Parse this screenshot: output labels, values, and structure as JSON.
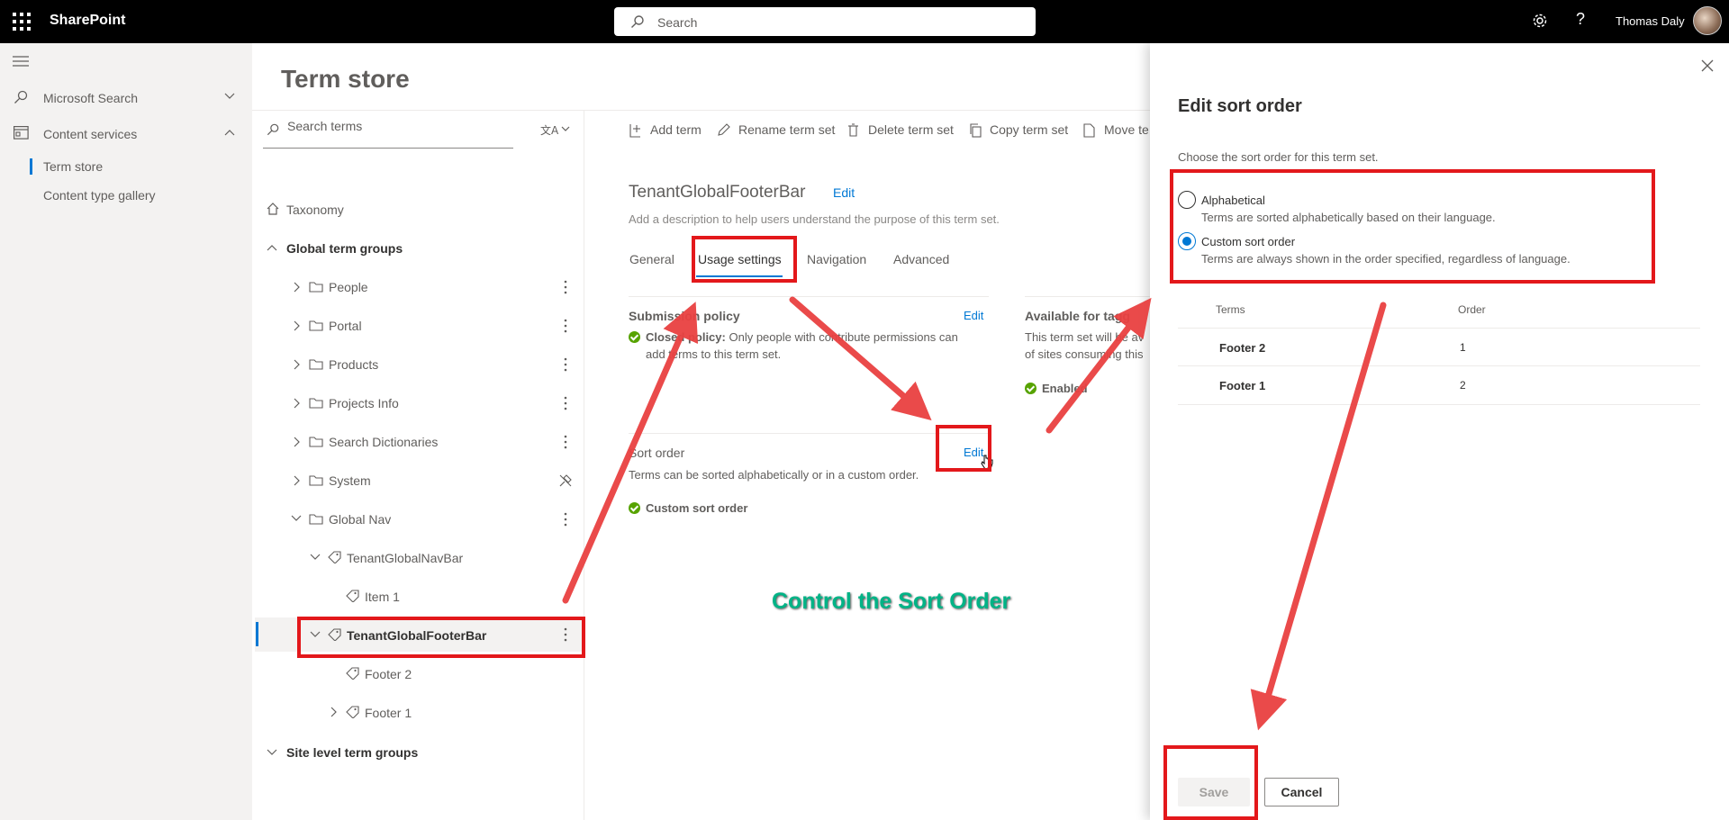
{
  "topbar": {
    "brand": "SharePoint",
    "search_placeholder": "Search",
    "user_name": "Thomas Daly",
    "help_label": "?"
  },
  "leftnav": {
    "items": [
      {
        "label": "Microsoft Search",
        "icon": "search-icon",
        "expanded": false
      },
      {
        "label": "Content services",
        "icon": "content-services-icon",
        "expanded": true
      }
    ],
    "sub_items": [
      "Term store",
      "Content type gallery"
    ],
    "selected": "Term store"
  },
  "page_title": "Term store",
  "tree": {
    "search_placeholder": "Search terms",
    "root": "Taxonomy",
    "global_group": "Global term groups",
    "groups": [
      "People",
      "Portal",
      "Products",
      "Projects Info",
      "Search Dictionaries",
      "System",
      "Global Nav"
    ],
    "term_sets": [
      "TenantGlobalNavBar",
      "TenantGlobalFooterBar"
    ],
    "nav_terms": [
      "Item 1"
    ],
    "footer_terms": [
      "Footer 2",
      "Footer 1"
    ],
    "site_group": "Site level term groups"
  },
  "commands": [
    "Add term",
    "Rename term set",
    "Delete term set",
    "Copy term set",
    "Move te"
  ],
  "termset": {
    "name": "TenantGlobalFooterBar",
    "edit_label": "Edit",
    "description": "Add a description to help users understand the purpose of this term set.",
    "tabs": [
      "General",
      "Usage settings",
      "Navigation",
      "Advanced"
    ],
    "active_tab": "Usage settings"
  },
  "cards": {
    "submission": {
      "title": "Submission policy",
      "edit": "Edit",
      "status_bold": "Closed policy:",
      "status_text": "Only people with contribute permissions can add terms to this term set."
    },
    "tagging": {
      "title": "Available for tagg",
      "text_line1": "This term set will be av",
      "text_line2": "of sites consuming this",
      "status": "Enabled"
    },
    "sort": {
      "title": "Sort order",
      "edit": "Edit",
      "text": "Terms can be sorted alphabetically or in a custom order.",
      "status": "Custom sort order"
    }
  },
  "caption": "Control the Sort Order",
  "panel": {
    "title": "Edit sort order",
    "description": "Choose the sort order for this term set.",
    "options": [
      {
        "label": "Alphabetical",
        "sub": "Terms are sorted alphabetically based on their language.",
        "selected": false
      },
      {
        "label": "Custom sort order",
        "sub": "Terms are always shown in the order specified, regardless of language.",
        "selected": true
      }
    ],
    "table": {
      "headers": [
        "Terms",
        "Order"
      ],
      "rows": [
        {
          "term": "Footer 2",
          "order": "1"
        },
        {
          "term": "Footer 1",
          "order": "2"
        }
      ]
    },
    "save_label": "Save",
    "cancel_label": "Cancel"
  },
  "colors": {
    "accent": "#0078d4",
    "annotation_red": "#e3181b",
    "caption_green": "#00b386",
    "success": "#57a300"
  }
}
